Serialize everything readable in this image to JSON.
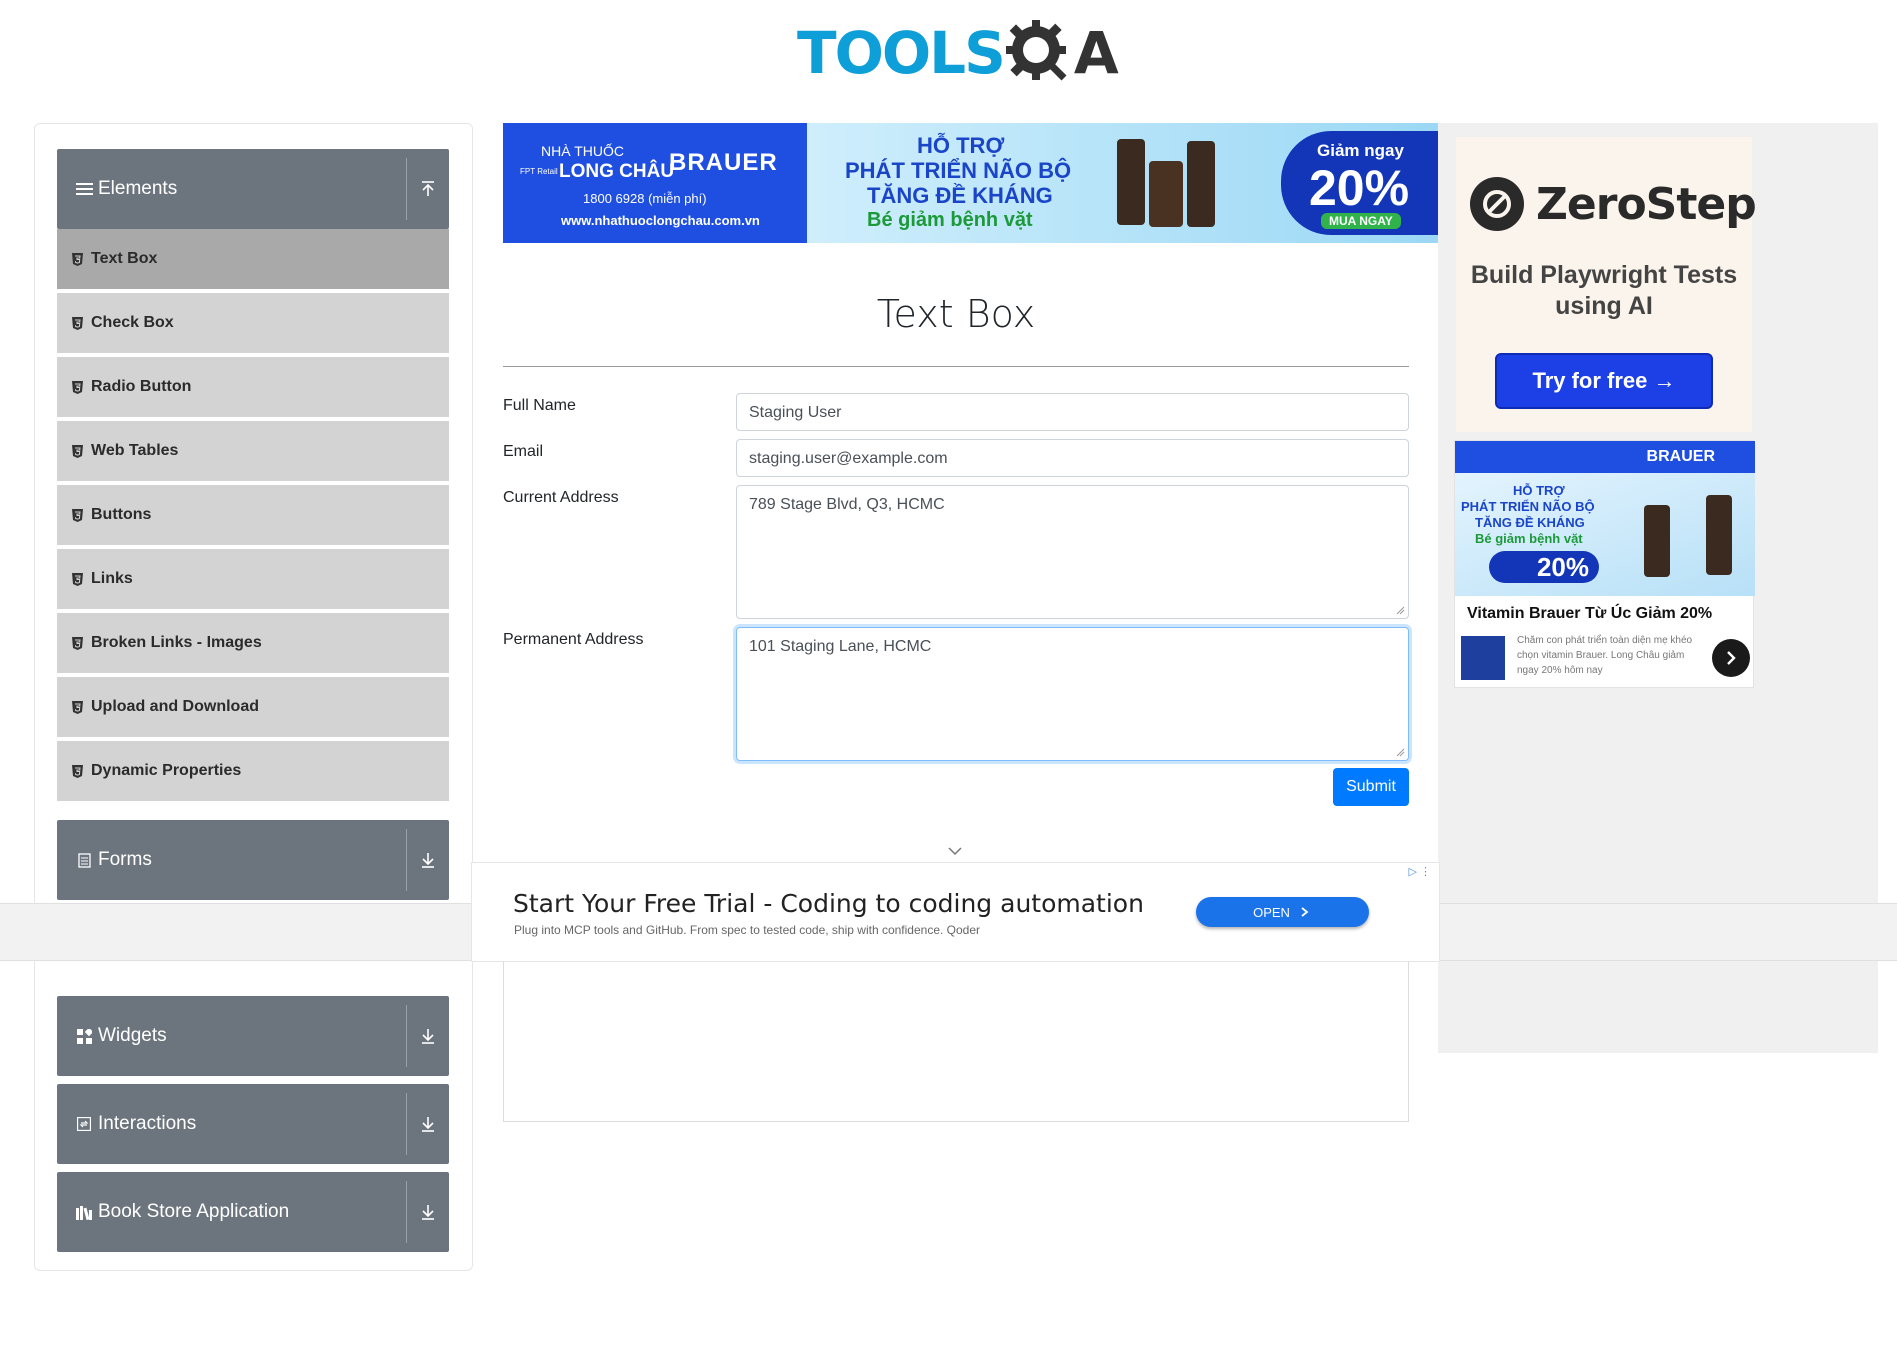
{
  "logo": {
    "left_text": "TOOLS",
    "right_text": "A"
  },
  "sidebar": {
    "elements_header": "Elements",
    "elements_items": [
      {
        "label": "Text Box"
      },
      {
        "label": "Check Box"
      },
      {
        "label": "Radio Button"
      },
      {
        "label": "Web Tables"
      },
      {
        "label": "Buttons"
      },
      {
        "label": "Links"
      },
      {
        "label": "Broken Links - Images"
      },
      {
        "label": "Upload and Download"
      },
      {
        "label": "Dynamic Properties"
      }
    ],
    "groups": [
      {
        "label": "Forms"
      },
      {
        "label": "Widgets"
      },
      {
        "label": "Interactions"
      },
      {
        "label": "Book Store Application"
      }
    ]
  },
  "top_ad": {
    "brand_small": "NHÀ THUỐC",
    "brand": "LONG CHÂU",
    "fpt": "FPT Retail",
    "product": "BRAUER",
    "phone": "1800 6928 (miễn phí)",
    "site": "www.nhathuoclongchau.com.vn",
    "line1": "HỖ TRỢ",
    "line2": "PHÁT TRIỂN NÃO BỘ",
    "line3": "TĂNG ĐỀ KHÁNG",
    "line4": "Bé giảm bệnh vặt",
    "discount_label": "Giảm ngay",
    "discount": "20%",
    "cta": "MUA NGAY"
  },
  "form": {
    "title": "Text Box",
    "full_name_label": "Full Name",
    "full_name_value": "Staging User",
    "email_label": "Email",
    "email_value": "staging.user@example.com",
    "current_address_label": "Current Address",
    "current_address_value": "789 Stage Blvd, Q3, HCMC",
    "permanent_address_label": "Permanent Address",
    "permanent_address_value": "101 Staging Lane, HCMC",
    "submit_label": "Submit"
  },
  "right_ad": {
    "zerostep_name": "ZeroStep",
    "zerostep_tagline": "Build Playwright Tests using AI",
    "zerostep_cta": "Try for free →",
    "lc_brand": "BRAUER",
    "lc_line1": "HỖ TRỢ",
    "lc_line2": "PHÁT TRIỂN NÃO BỘ",
    "lc_line3": "TĂNG ĐỀ KHÁNG",
    "lc_line4": "Bé giảm bệnh vặt",
    "lc_discount": "20%",
    "lc_title": "Vitamin Brauer Từ Úc Giảm 20%",
    "lc_desc": "Chăm con phát triển toàn diện mẹ khéo chọn vitamin Brauer. Long Châu giảm ngay 20% hôm nay"
  },
  "bottom_ad": {
    "title": "Start Your Free Trial - Coding to coding automation",
    "subtitle": "Plug into MCP tools and GitHub. From spec to tested code, ship with confidence. Qoder",
    "cta": "OPEN"
  },
  "colors": {
    "sidebar_header": "#6c757d",
    "menu_item": "#d3d3d3",
    "menu_active": "#a9a9a9",
    "primary": "#007bff",
    "logo_blue": "#0f9fd8"
  }
}
